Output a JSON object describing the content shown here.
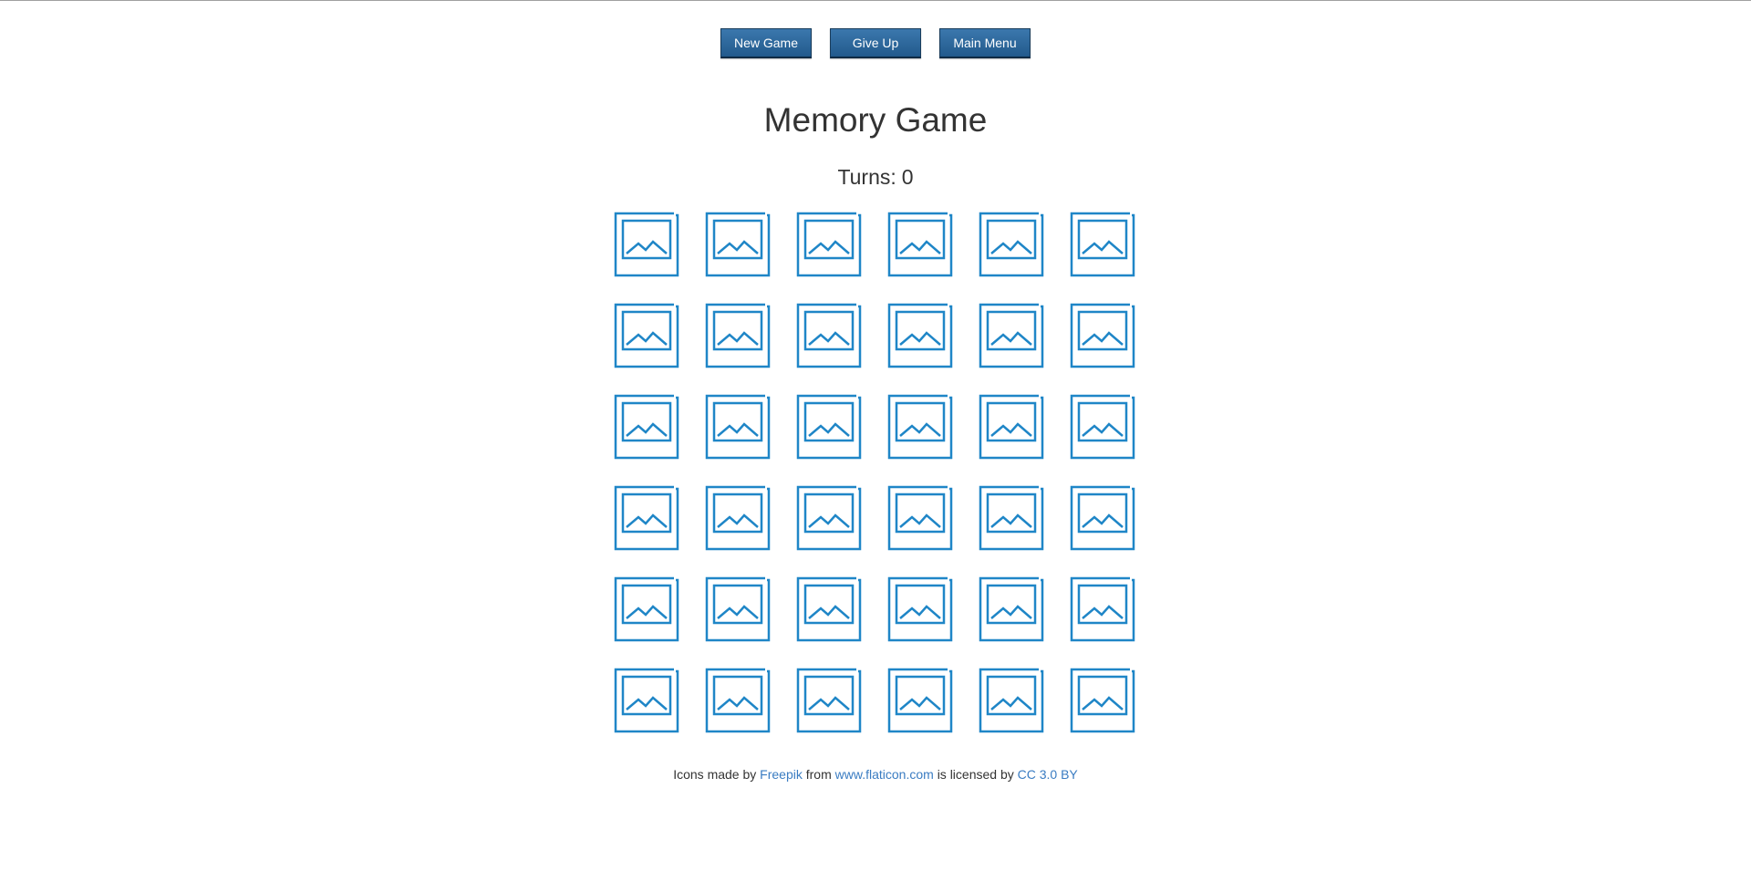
{
  "toolbar": {
    "new_game_label": "New Game",
    "give_up_label": "Give Up",
    "main_menu_label": "Main Menu"
  },
  "header": {
    "title": "Memory Game"
  },
  "status": {
    "turns_label": "Turns:",
    "turns_value": "0"
  },
  "board": {
    "rows": 6,
    "columns": 6,
    "card_back_icon": "image-placeholder-icon",
    "card_icon_color": "#1f86c7",
    "cards_face_down": 36
  },
  "credits": {
    "prefix": "Icons made by",
    "author_link": "Freepik",
    "from_text": "from",
    "site_link": "www.flaticon.com",
    "licensed_text": "is licensed by",
    "license_link": "CC 3.0 BY",
    "link_color": "#3a7cc2"
  },
  "colors": {
    "button_bg": "#2d6aa0",
    "button_text": "#ffffff",
    "text": "#333333"
  }
}
